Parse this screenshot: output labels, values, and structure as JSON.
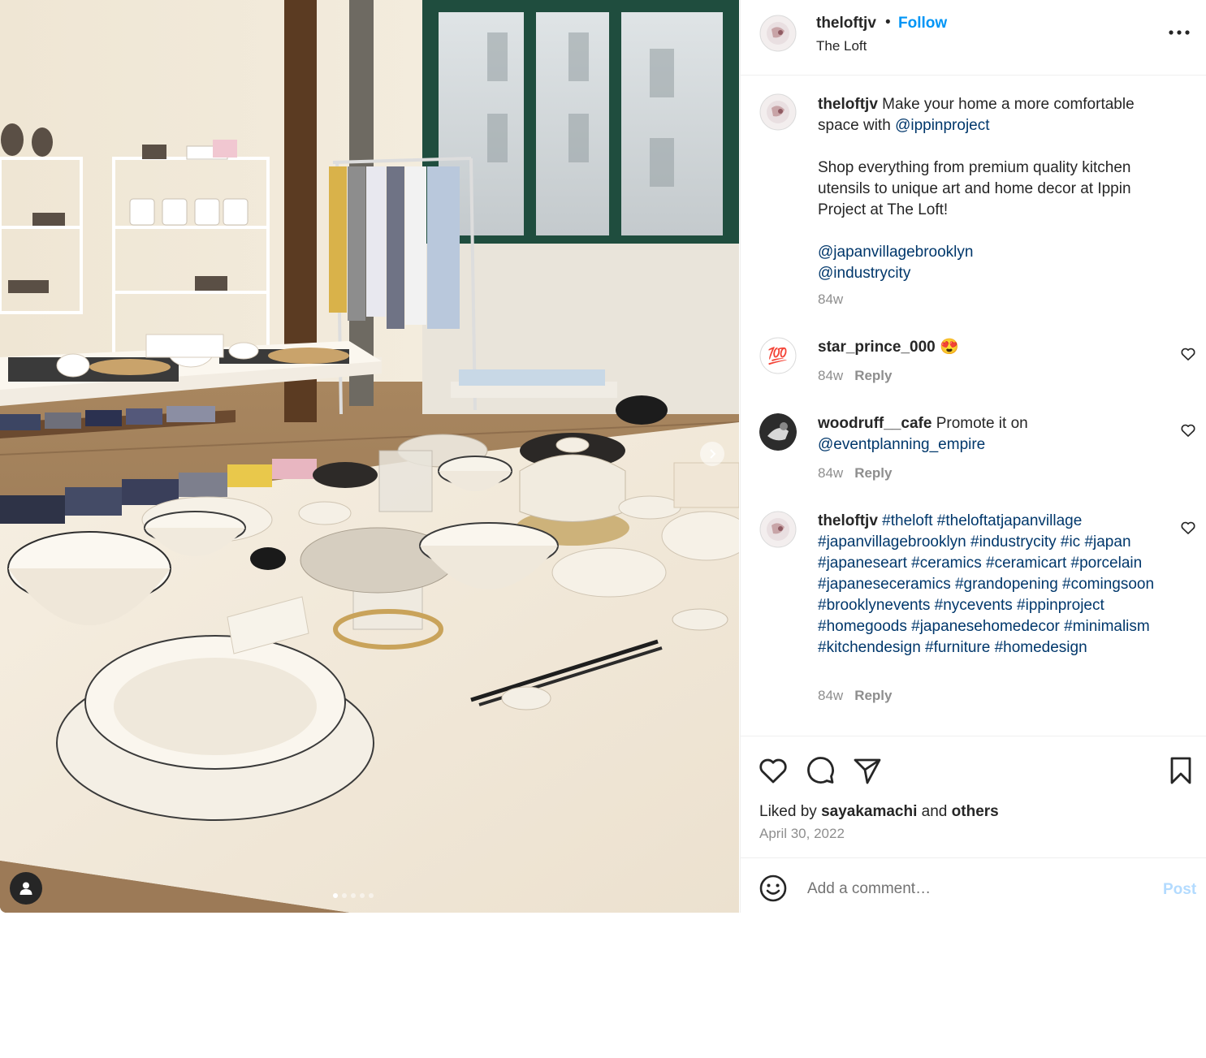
{
  "post": {
    "author": "theloftjv",
    "separator": "•",
    "follow_label": "Follow",
    "location": "The Loft",
    "carousel": {
      "slide_count": 5,
      "active_slide": 1
    }
  },
  "caption": {
    "username": "theloftjv",
    "text_1": "Make your home a more comfortable space with",
    "mention_1": "@ippinproject",
    "paragraph_2": "Shop everything from premium quality kitchen utensils to unique art and home decor at Ippin Project at The Loft!",
    "mention_2": "@japanvillagebrooklyn",
    "mention_3": "@industrycity",
    "time": "84w"
  },
  "comments": [
    {
      "username": "star_prince_000",
      "text": "😍",
      "avatar_glyph": "💯",
      "time": "84w",
      "reply_label": "Reply"
    },
    {
      "username": "woodruff__cafe",
      "text": "Promote it on",
      "mention": "@eventplanning_empire",
      "time": "84w",
      "reply_label": "Reply"
    },
    {
      "username": "theloftjv",
      "hashtags": "#theloft #theloftatjapanvillage #japanvillagebrooklyn #industrycity #ic #japan #japaneseart #ceramics #ceramicart #porcelain #japaneseceramics #grandopening #comingsoon #brooklynevents #nycevents #ippinproject #homegoods #japanesehomedecor #minimalism #kitchendesign #furniture #homedesign",
      "time": "84w",
      "reply_label": "Reply"
    }
  ],
  "engagement": {
    "liked_prefix": "Liked by",
    "liked_user": "sayakamachi",
    "liked_and": "and",
    "liked_others": "others",
    "date": "April 30, 2022"
  },
  "add_comment": {
    "placeholder": "Add a comment…",
    "post_label": "Post"
  },
  "icons": {
    "like": "heart-icon",
    "comment": "comment-bubble-icon",
    "share": "paper-plane-icon",
    "save": "bookmark-icon",
    "more": "more-options-icon",
    "emoji": "emoji-smile-icon",
    "user_tag": "user-tag-icon",
    "next": "chevron-right-icon"
  },
  "colors": {
    "link": "#0095f6",
    "mention": "#00376b",
    "muted": "#8e8e8e",
    "text": "#262626",
    "post_disabled": "#b3dbff"
  }
}
